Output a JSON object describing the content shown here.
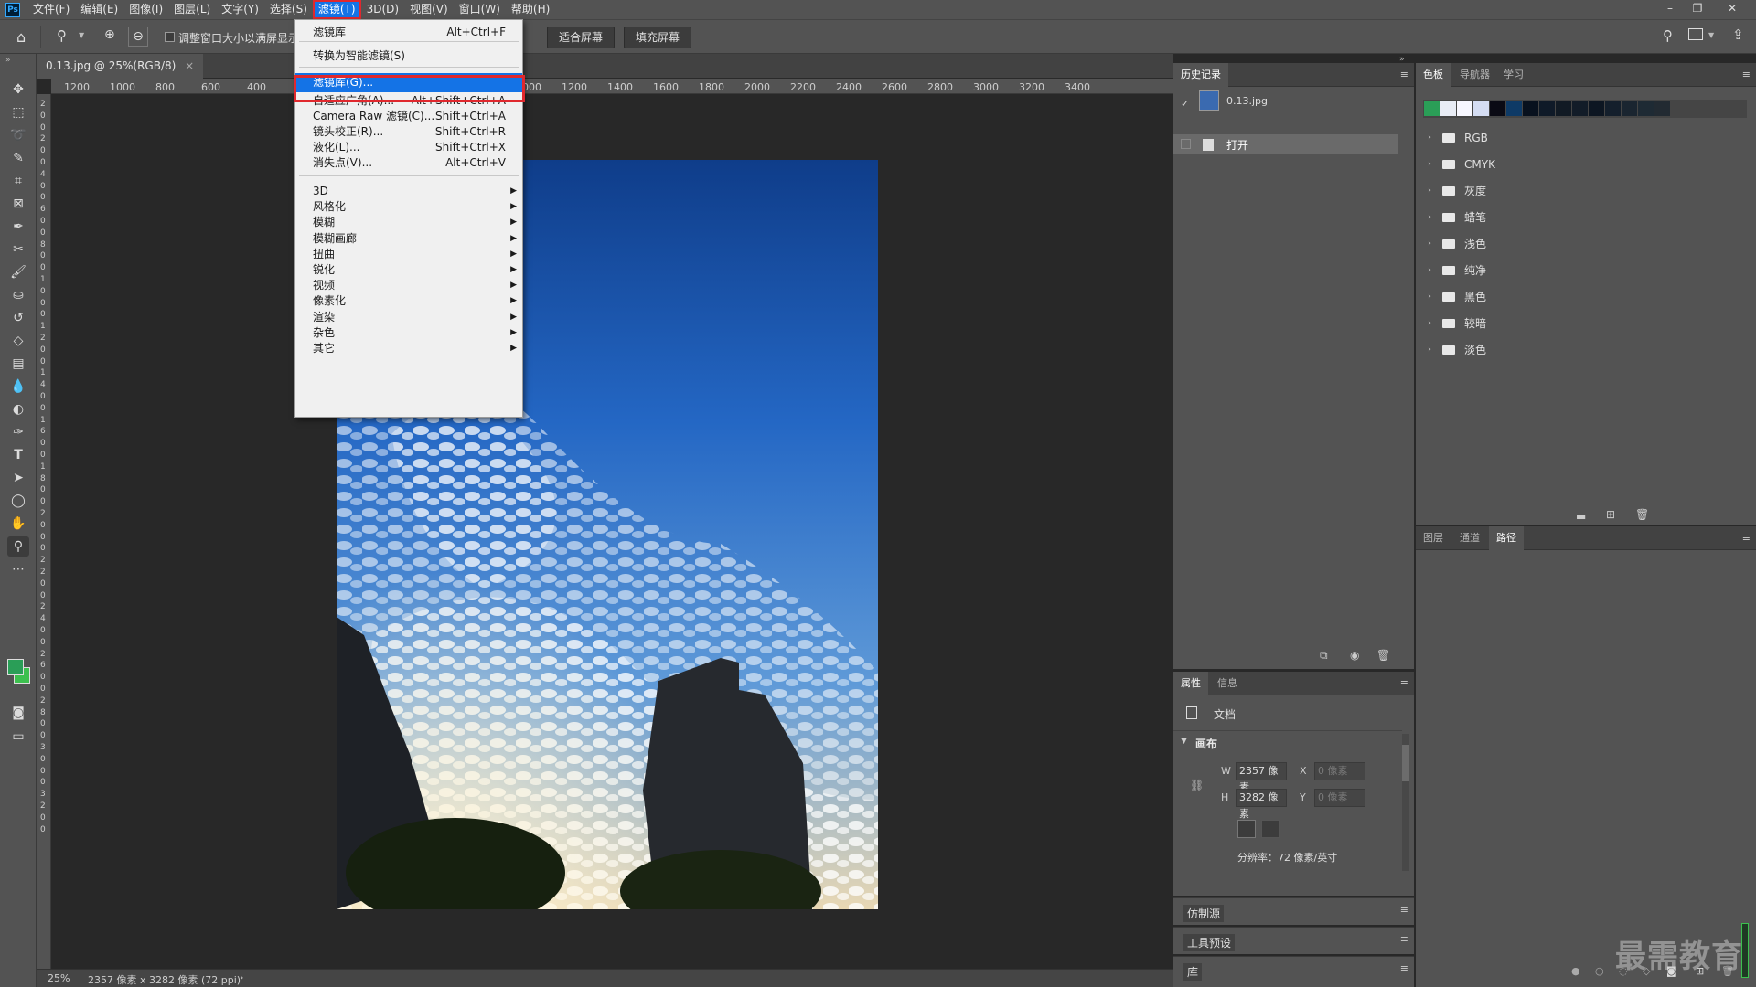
{
  "menubar": {
    "app_icon": "Ps",
    "items": [
      "文件(F)",
      "编辑(E)",
      "图像(I)",
      "图层(L)",
      "文字(Y)",
      "选择(S)",
      "滤镜(T)",
      "3D(D)",
      "视图(V)",
      "窗口(W)",
      "帮助(H)"
    ],
    "active_index": 6,
    "window_controls": [
      "minimize-icon",
      "restore-icon",
      "close-icon"
    ]
  },
  "options_bar": {
    "checkbox_label": "调整窗口大小以满屏显示",
    "fit_screen": "适合屏幕",
    "fill_screen": "填充屏幕"
  },
  "document": {
    "tab_title": "0.13.jpg @ 25%(RGB/8)",
    "tab_close": "×",
    "zoom": "25%",
    "status_info": "2357 像素 x 3282 像素 (72 ppi)",
    "status_arrow": "›"
  },
  "ruler": {
    "h_ticks": [
      "1200",
      "1000",
      "800",
      "600",
      "400",
      "1000",
      "1200",
      "1400",
      "1600",
      "1800",
      "2000",
      "2200",
      "2400",
      "2600",
      "2800",
      "3000",
      "3200",
      "3400"
    ],
    "v_ticks": [
      "2",
      "0",
      "0",
      "2",
      "0",
      "0",
      "4",
      "0",
      "0",
      "6",
      "0",
      "0",
      "8",
      "0",
      "0",
      "1",
      "0",
      "0",
      "0",
      "1",
      "2",
      "0",
      "0",
      "1",
      "4",
      "0",
      "0",
      "1",
      "6",
      "0",
      "0",
      "1",
      "8",
      "0",
      "0",
      "2",
      "0",
      "0",
      "0",
      "2",
      "2",
      "0",
      "0",
      "2",
      "4",
      "0",
      "0",
      "2",
      "6",
      "0",
      "0",
      "2",
      "8",
      "0",
      "0",
      "3",
      "0",
      "0",
      "0",
      "3",
      "2",
      "0",
      "0"
    ]
  },
  "filter_menu": {
    "items": [
      {
        "label": "滤镜库",
        "shortcut": "Alt+Ctrl+F"
      },
      {
        "label": "转换为智能滤镜(S)",
        "shortcut": ""
      },
      {
        "label": "滤镜库(G)...",
        "shortcut": "",
        "highlighted": true
      },
      {
        "label": "自适应广角(A)...",
        "shortcut": "Alt+Shift+Ctrl+A"
      },
      {
        "label": "Camera Raw 滤镜(C)...",
        "shortcut": "Shift+Ctrl+A"
      },
      {
        "label": "镜头校正(R)...",
        "shortcut": "Shift+Ctrl+R"
      },
      {
        "label": "液化(L)...",
        "shortcut": "Shift+Ctrl+X"
      },
      {
        "label": "消失点(V)...",
        "shortcut": "Alt+Ctrl+V"
      }
    ],
    "submenus": [
      "3D",
      "风格化",
      "模糊",
      "模糊画廊",
      "扭曲",
      "锐化",
      "视频",
      "像素化",
      "渲染",
      "杂色",
      "其它"
    ],
    "submenu_arrow": "▶"
  },
  "history_panel": {
    "tab": "历史记录",
    "snapshot_label": "0.13.jpg",
    "states": [
      "打开"
    ]
  },
  "swatches_panel": {
    "tabs": [
      "色板",
      "导航器",
      "学习"
    ],
    "colors": [
      "#2a9e57",
      "#e8ecf5",
      "#f7f7ff",
      "#d4dcf2",
      "#0a0a14",
      "#0e3a66",
      "#08111e",
      "#0f1a28",
      "#111a24",
      "#121c28",
      "#0d1622",
      "#141f2c",
      "#1a2530",
      "#1e2a34",
      "#222a32"
    ],
    "groups": [
      "RGB",
      "CMYK",
      "灰度",
      "蜡笔",
      "浅色",
      "纯净",
      "黑色",
      "较暗",
      "淡色"
    ]
  },
  "properties_panel": {
    "tabs": [
      "属性",
      "信息"
    ],
    "doc_label": "文档",
    "section": "画布",
    "w_label": "W",
    "w_value": "2357 像素",
    "h_label": "H",
    "h_value": "3282 像素",
    "x_label": "X",
    "x_value": "0 像素",
    "y_label": "Y",
    "y_value": "0 像素",
    "resolution": "分辨率：72 像素/英寸"
  },
  "collapsed_panels": [
    "仿制源",
    "工具预设",
    "库"
  ],
  "layers_panel": {
    "tabs": [
      "图层",
      "通道",
      "路径"
    ],
    "active_tab": 2
  },
  "watermark": "最需教育",
  "colors": {
    "accent": "#1473e6",
    "highlight_red": "#e0282e",
    "foreground_swatch": "#2a9e57",
    "background_swatch": "#3cc04e"
  }
}
